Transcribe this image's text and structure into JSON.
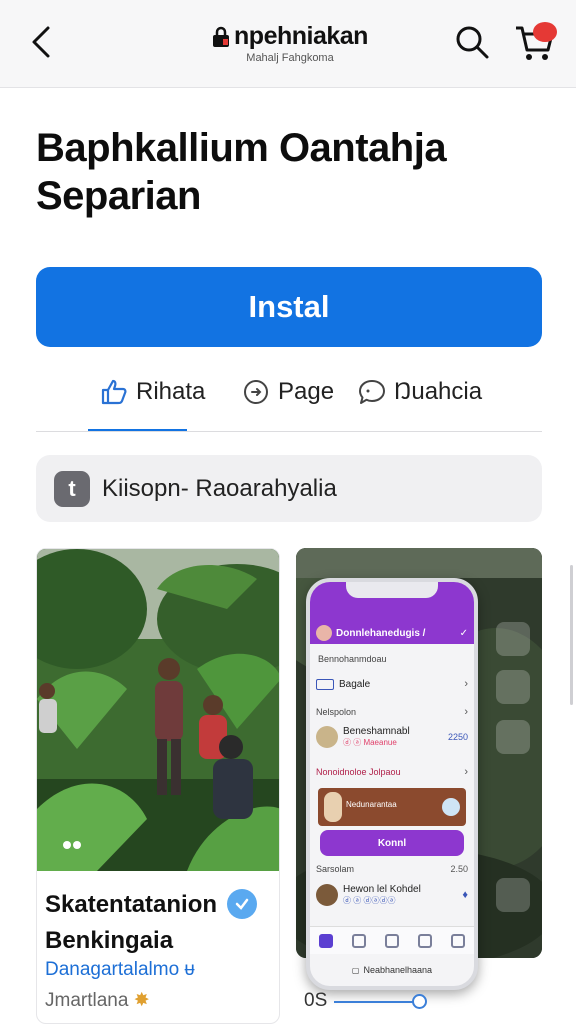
{
  "header": {
    "brand_title": "npehniakan",
    "brand_subtitle": "Mahalj Fahgkoma"
  },
  "app": {
    "title_line1": "Baphkallium Oantahja",
    "title_line2": "Separian"
  },
  "install_label": "Instal",
  "actions": [
    {
      "label": "Rihata",
      "icon": "thumbs-up-icon"
    },
    {
      "label": "Page",
      "icon": "share-icon"
    },
    {
      "label": "Ŋuahcia",
      "icon": "chat-icon"
    }
  ],
  "category": {
    "icon_text": "t",
    "label": "Kiisopn- Raoarahyalia"
  },
  "screenshot1": {
    "title_line1": "Skatentatanion",
    "title_line2": "Benkingaia",
    "subtitle": "Danagartalalmo ᵾ",
    "author": "Jmartlana"
  },
  "screenshot2": {
    "header_title": "Donnlehanedugis /",
    "tag": "Bennohanmdoau",
    "row1_label": "Bagale",
    "section1": "Nelspolon",
    "item1_title": "Beneshamnabl",
    "item1_meta": "ⓓ ⓐ Maeanue",
    "item1_value": "2250",
    "section2": "Nonoidnoloe Jolpaou",
    "banner_text": "Nedunarantaa",
    "button_label": "Konnl",
    "section3": "Sarsolam",
    "section3_value": "2.50",
    "item2_title": "Hewon lel Kohdel",
    "item2_meta": "ⓓ ⓐ ⓓⓐⓓⓐ",
    "item2_badge": "♦",
    "home_text": "Neabhanelhaana"
  },
  "progress_label": "0S",
  "colors": {
    "primary": "#1273e2",
    "purple": "#8d37cf",
    "badge": "#e53935"
  }
}
